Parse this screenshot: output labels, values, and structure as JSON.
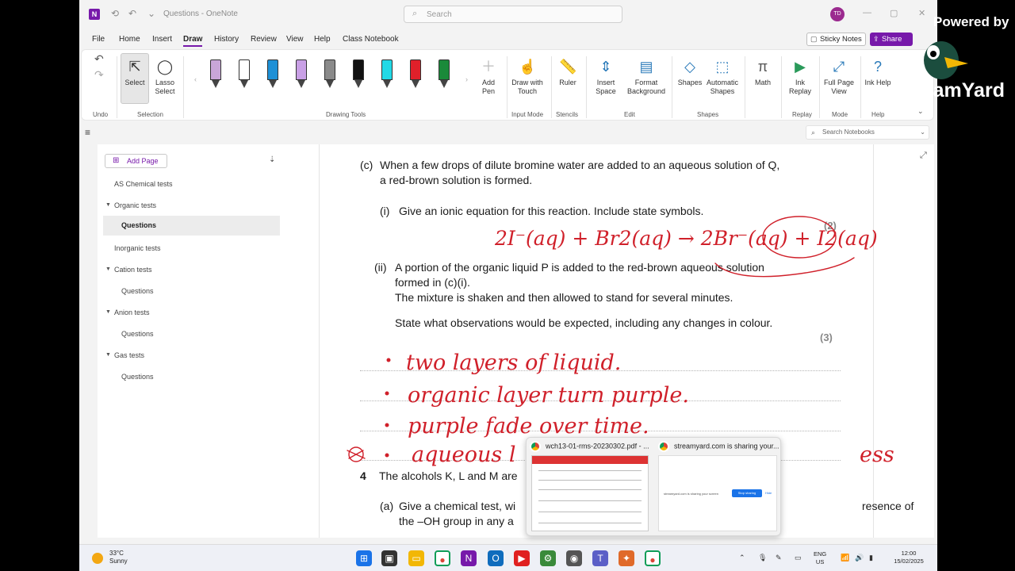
{
  "window": {
    "title": "Questions - OneNote",
    "search_placeholder": "Search",
    "avatar_initials": "TD"
  },
  "menu": [
    "File",
    "Home",
    "Insert",
    "Draw",
    "History",
    "Review",
    "View",
    "Help",
    "Class Notebook"
  ],
  "active_menu": "Draw",
  "header_buttons": {
    "sticky_notes": "Sticky Notes",
    "share": "Share"
  },
  "ribbon": {
    "undo_group": "Undo",
    "select": "Select",
    "lasso": "Lasso Select",
    "selection_group": "Selection",
    "drawing_tools_group": "Drawing Tools",
    "add_pen": "Add Pen",
    "draw_with_touch": "Draw with Touch",
    "input_mode_group": "Input Mode",
    "ruler": "Ruler",
    "stencils_group": "Stencils",
    "insert_space": "Insert Space",
    "format_background": "Format Background",
    "edit_group": "Edit",
    "shapes": "Shapes",
    "automatic_shapes": "Automatic Shapes",
    "shapes_group": "Shapes",
    "math": "Math",
    "ink_replay": "Ink Replay",
    "replay_group": "Replay",
    "full_page_view": "Full Page View",
    "mode_group": "Mode",
    "ink_help": "Ink Help",
    "help_group": "Help",
    "pen_colors": [
      "#c9a6d8",
      "#ffffff",
      "#1e90d6",
      "#c9a0e6",
      "#8a8a8a",
      "#111111",
      "#22d9e6",
      "#e0202a",
      "#1a8a3a"
    ]
  },
  "search_notebooks": "Search Notebooks",
  "pagelist": {
    "add_page": "Add Page",
    "items": [
      {
        "label": "AS Chemical tests"
      },
      {
        "label": "Organic tests"
      },
      {
        "label": "Questions"
      },
      {
        "label": "Inorganic tests"
      },
      {
        "label": "Cation tests"
      },
      {
        "label": "Questions"
      },
      {
        "label": "Anion tests"
      },
      {
        "label": "Questions"
      },
      {
        "label": "Gas tests"
      },
      {
        "label": "Questions"
      }
    ]
  },
  "question": {
    "c_label": "(c)",
    "c_line1": "When a few drops of dilute bromine water are added to an aqueous solution of Q,",
    "c_line2": "a red-brown solution is formed.",
    "i_label": "(i)",
    "i_text": "Give an ionic equation for this reaction. Include state symbols.",
    "i_marks": "(2)",
    "ii_label": "(ii)",
    "ii_line1": "A portion of the organic liquid P is added to the red-brown aqueous solution",
    "ii_line2": "formed in (c)(i).",
    "ii_line3": "The mixture is shaken and then allowed to stand for several minutes.",
    "ii_line4": "State what observations would be expected, including any changes in colour.",
    "ii_marks": "(3)",
    "q4_label": "4",
    "q4_text": "The alcohols K, L and M are",
    "a_label": "(a)",
    "a_line1": "Give a chemical test, wi",
    "a_line1_end": "resence of",
    "a_line2": "the –OH group in any a"
  },
  "handwriting": {
    "equation": "2I⁻(aq) + Br2(aq) → 2Br⁻(aq) + I2(aq)",
    "answers": [
      "two layers of liquid.",
      "organic layer turn purple.",
      "purple fade over time.",
      "aqueous l",
      "ess"
    ]
  },
  "popup": {
    "tab1": "wch13-01-rms-20230302.pdf - ...",
    "tab2": "streamyard.com is sharing your...",
    "share_msg": "streamyard.com is sharing your screen",
    "stop_sharing": "Stop sharing",
    "hide": "Hide"
  },
  "taskbar": {
    "temp": "33°C",
    "weather": "Sunny",
    "lang1": "ENG",
    "lang2": "US",
    "time": "12:00",
    "date": "15/02/2025"
  },
  "overlay": {
    "powered_by": "Powered by",
    "brand": "StreamYard"
  },
  "colors": {
    "accent": "#7719aa",
    "ink": "#d0202a"
  }
}
